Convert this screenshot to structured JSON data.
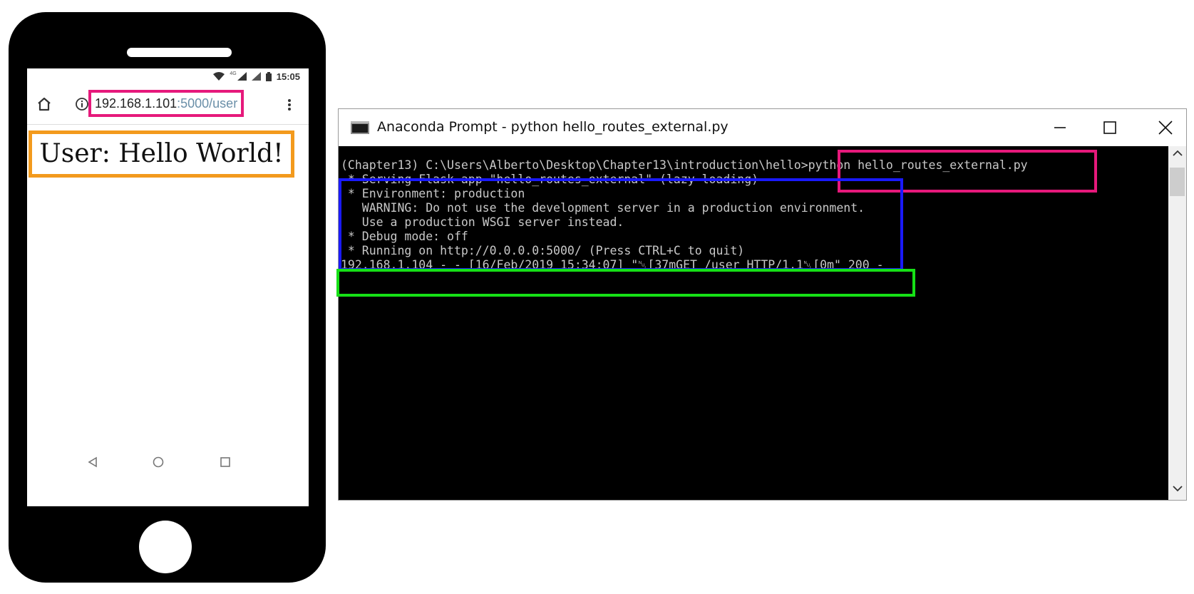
{
  "phone": {
    "status": {
      "time": "15:05",
      "network_label": "4G"
    },
    "browser": {
      "url_host": "192.168.1.101",
      "url_path": ":5000/user"
    },
    "page": {
      "heading": "User: Hello World!"
    }
  },
  "terminal": {
    "title": "Anaconda Prompt - python  hello_routes_external.py",
    "lines": [
      "(Chapter13) C:\\Users\\Alberto\\Desktop\\Chapter13\\introduction\\hello>python hello_routes_external.py",
      " * Serving Flask app \"hello_routes_external\" (lazy loading)",
      " * Environment: production",
      "   WARNING: Do not use the development server in a production environment.",
      "   Use a production WSGI server instead.",
      " * Debug mode: off",
      " * Running on http://0.0.0.0:5000/ (Press CTRL+C to quit)",
      "192.168.1.104 - - [16/Feb/2019 15:34:07] \"␀[37mGET /user HTTP/1.1␀[0m\" 200 -"
    ]
  },
  "highlight_colors": {
    "url": "#e6197b",
    "heading": "#f39a1d",
    "command": "#e6197b",
    "server_output": "#1a1aff",
    "request_log": "#16e016"
  },
  "icons": {
    "phone": [
      "wifi-icon",
      "signal-icon",
      "battery-icon",
      "home-icon",
      "info-icon",
      "overflow-menu-icon",
      "nav-back-icon",
      "nav-home-icon",
      "nav-recents-icon"
    ],
    "window": [
      "console-app-icon",
      "minimize-icon",
      "maximize-icon",
      "close-icon",
      "scroll-up-icon",
      "scroll-down-icon"
    ]
  }
}
